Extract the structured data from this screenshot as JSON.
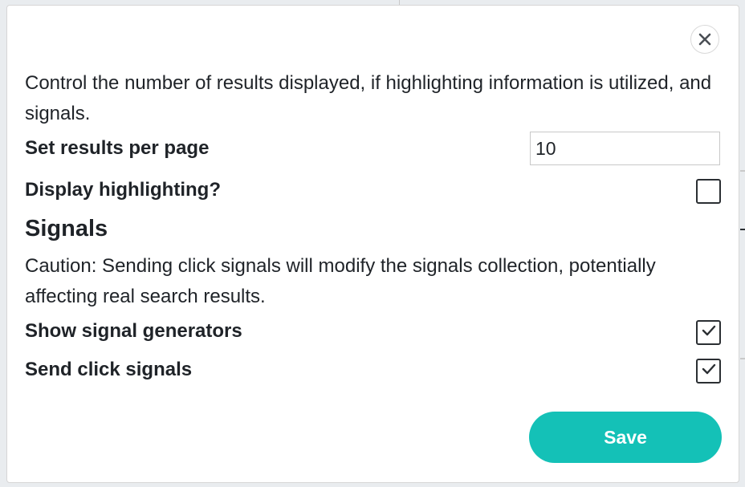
{
  "dialog": {
    "description": "Control the number of results displayed, if highlighting information is utilized, and signals.",
    "close_icon": "close-icon",
    "results_per_page": {
      "label": "Set results per page",
      "value": "10"
    },
    "display_highlighting": {
      "label": "Display highlighting?",
      "checked": false
    },
    "signals": {
      "heading": "Signals",
      "caution": "Caution: Sending click signals will modify the signals collection, potentially affecting real search results.",
      "show_generators": {
        "label": "Show signal generators",
        "checked": true
      },
      "send_click_signals": {
        "label": "Send click signals",
        "checked": true
      }
    },
    "save_label": "Save"
  },
  "colors": {
    "accent": "#14c1b7",
    "text": "#1f2328"
  }
}
